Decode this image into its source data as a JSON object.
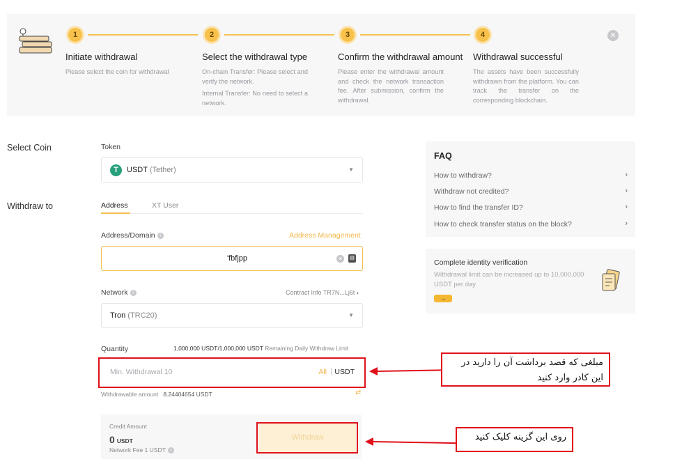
{
  "steps": [
    {
      "number": "1",
      "title": "Initiate withdrawal",
      "desc": [
        "Please select the coin for withdrawal"
      ]
    },
    {
      "number": "2",
      "title": "Select the withdrawal type",
      "desc": [
        "On-chain Transfer: Please select and verify the network.",
        "Internal Transfer: No need to select a network."
      ]
    },
    {
      "number": "3",
      "title": "Confirm the withdrawal amount",
      "desc": [
        "Please enter the withdrawal amount and check the network transaction fee. After submission, confirm the withdrawal."
      ]
    },
    {
      "number": "4",
      "title": "Withdrawal successful",
      "desc": [
        "The assets have been successfully withdrawn from the platform. You can track the transfer on the corresponding blockchain."
      ]
    }
  ],
  "select_coin": {
    "label": "Select Coin",
    "token_label": "Token",
    "token_symbol": "USDT",
    "token_name": "(Tether)",
    "token_icon": "tether-icon"
  },
  "withdraw_to": {
    "label": "Withdraw to",
    "tab_address": "Address",
    "tab_xt_user": "XT User",
    "address_label": "Address/Domain",
    "address_management": "Address Management",
    "address_value": "'fbfjpp",
    "network_label": "Network",
    "contract_info": "Contract Info TR7N...Lj6t",
    "network_name": "Tron",
    "network_sub": "(TRC20)"
  },
  "quantity": {
    "label": "Quantity",
    "limit_value": "1,000,000 USDT/1,000,000 USDT",
    "limit_label": "Remaining Daily Withdraw Limit",
    "placeholder": "Min. Withdrawal 10",
    "all": "All",
    "separator": "|",
    "unit": "USDT",
    "withdrawable_label": "Withdrawable amount",
    "withdrawable_value": "8.24404654 USDT"
  },
  "credit": {
    "label": "Credit Amount",
    "amount": "0",
    "unit": "USDT",
    "fee": "Network Fee 1 USDT"
  },
  "withdraw_button": "Withdraw",
  "faq": {
    "title": "FAQ",
    "items": [
      "How to withdraw?",
      "Withdraw not credited?",
      "How to find the transfer ID?",
      "How to check transfer status on the block?"
    ]
  },
  "verification": {
    "title": "Complete identity verification",
    "desc": "Withdrawal limit can be increased up to 10,000,000 USDT per day",
    "button": "→"
  },
  "annotations": {
    "quantity_note": "مبلغی که قصد برداشت آن را دارید در این کادر وارد کنید",
    "button_note": "روی این گزینه کلیک کنید"
  },
  "colors": {
    "accent": "#f3c24f",
    "annotation_red": "#e0101a",
    "tether_green": "#26a17b"
  }
}
